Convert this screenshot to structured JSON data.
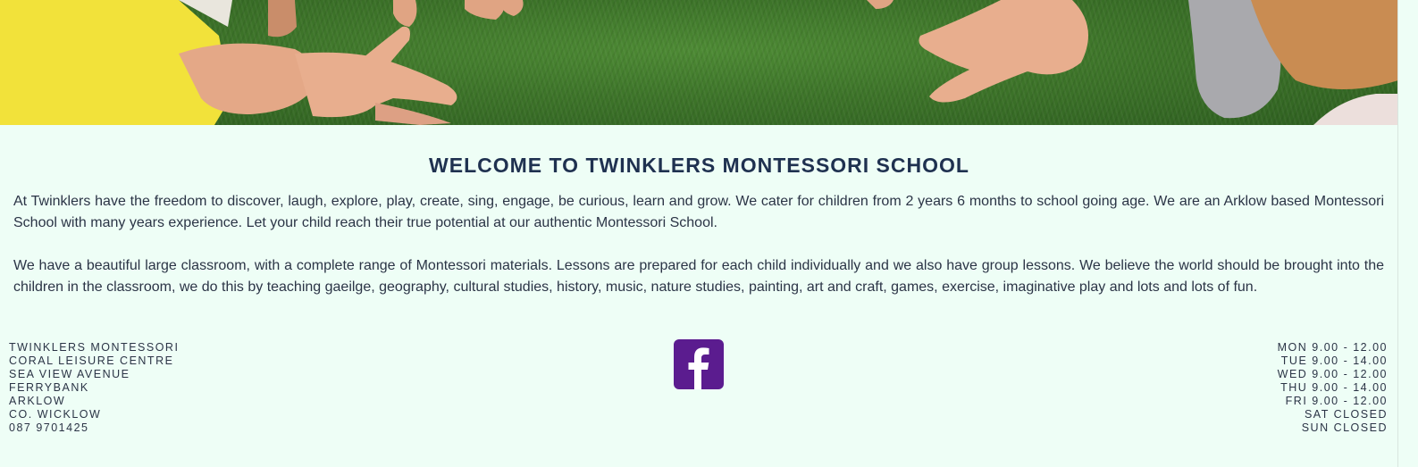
{
  "hero": {
    "image": "children-hands-on-grass-photo"
  },
  "welcome": {
    "title": "WELCOME TO TWINKLERS MONTESSORI SCHOOL",
    "paragraph_1": "At Twinklers have the freedom to discover, laugh, explore, play, create, sing, engage, be curious, learn and grow. We cater for children from 2 years 6 months to school going age. We are an Arklow based Montessori School with many years experience. Let your child reach their true potential at our authentic Montessori School.",
    "paragraph_2": "We have a beautiful large classroom, with a complete range of Montessori materials. Lessons are prepared for each child individually and we also have group lessons. We believe the world should be brought into the children in the classroom, we do this by teaching gaeilge, geography, cultural studies, history, music, nature studies, painting, art and craft, games, exercise, imaginative play and lots and lots of fun."
  },
  "footer": {
    "address": [
      "TWINKLERS MONTESSORI",
      "CORAL LEISURE CENTRE",
      "SEA VIEW AVENUE",
      "FERRYBANK",
      "ARKLOW",
      "CO. WICKLOW",
      "087 9701425"
    ],
    "social": {
      "icon": "facebook-icon",
      "color": "#5b1c8f"
    },
    "hours": [
      "MON 9.00 - 12.00",
      "TUE 9.00 - 14.00",
      "WED 9.00 - 12.00",
      "THU 9.00 - 14.00",
      "FRI 9.00 - 12.00",
      "SAT CLOSED",
      "SUN CLOSED"
    ]
  },
  "colors": {
    "background": "#eefef6",
    "heading": "#1f3150",
    "text": "#2b3446",
    "facebook": "#5b1c8f"
  }
}
